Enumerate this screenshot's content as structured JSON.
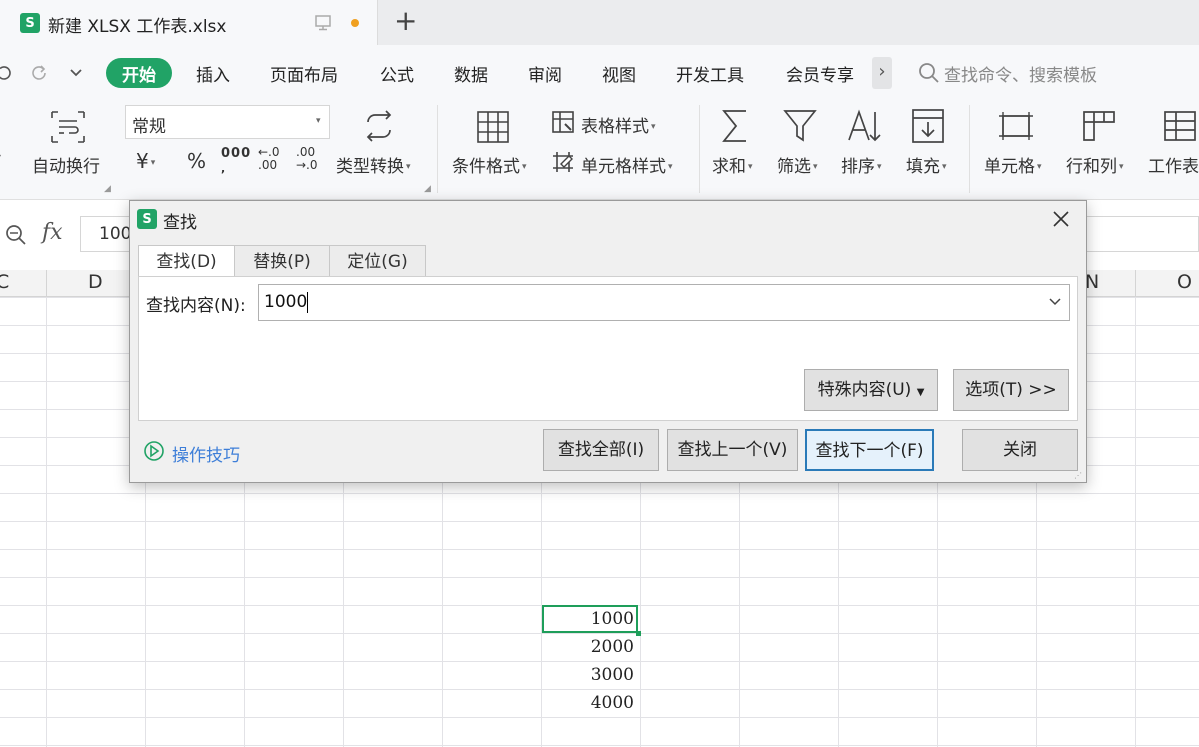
{
  "titlebar": {
    "doc_title": "新建 XLSX 工作表.xlsx",
    "new_tab": "+",
    "logo": "S"
  },
  "menubar": {
    "items": [
      "开始",
      "插入",
      "页面布局",
      "公式",
      "数据",
      "审阅",
      "视图",
      "开发工具",
      "会员专享"
    ],
    "more": "›",
    "search_placeholder": "查找命令、搜索模板"
  },
  "ribbon": {
    "wrap": "自动换行",
    "number_format": "常规",
    "currency": "¥",
    "percent": "%",
    "thousands": "000",
    "inc_decimal_top": "←.0",
    "inc_decimal_bottom": ".00",
    "dec_decimal_top": ".00",
    "dec_decimal_bottom": "→.0",
    "type_convert": "类型转换",
    "conditional_format": "条件格式",
    "table_style": "表格样式",
    "cell_style": "单元格样式",
    "sum": "求和",
    "filter": "筛选",
    "sort": "排序",
    "fill": "填充",
    "cell": "单元格",
    "row_col": "行和列",
    "worksheet": "工作表"
  },
  "formula_bar": {
    "fx": "fx",
    "value": "100"
  },
  "columns": [
    "C",
    "D",
    "N",
    "O"
  ],
  "cells": [
    "1000",
    "2000",
    "3000",
    "4000"
  ],
  "dialog": {
    "title": "查找",
    "tabs": [
      "查找(D)",
      "替换(P)",
      "定位(G)"
    ],
    "find_label": "查找内容(N):",
    "find_value": "1000",
    "special": "特殊内容(U)",
    "options": "选项(T) >>",
    "tips": "操作技巧",
    "find_all": "查找全部(I)",
    "find_prev": "查找上一个(V)",
    "find_next": "查找下一个(F)",
    "close": "关闭"
  },
  "colors": {
    "accent": "#21a366",
    "active_cell": "#1e9e5a",
    "link": "#3d7ed8",
    "dot": "#f0a020"
  }
}
